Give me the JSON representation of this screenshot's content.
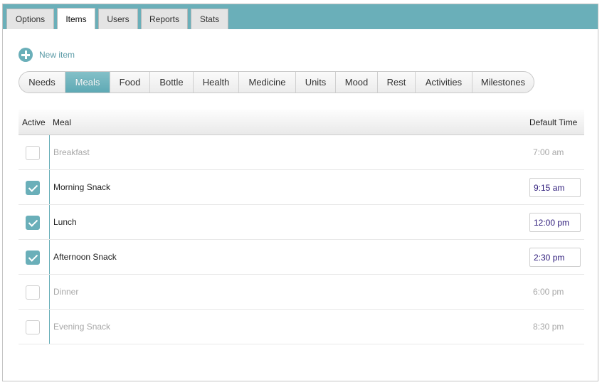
{
  "tabs": [
    {
      "label": "Options",
      "active": false
    },
    {
      "label": "Items",
      "active": true
    },
    {
      "label": "Users",
      "active": false
    },
    {
      "label": "Reports",
      "active": false
    },
    {
      "label": "Stats",
      "active": false
    }
  ],
  "new_item": {
    "label": "New item",
    "icon": "plus-circle-icon"
  },
  "categories": [
    {
      "label": "Needs",
      "active": false
    },
    {
      "label": "Meals",
      "active": true
    },
    {
      "label": "Food",
      "active": false
    },
    {
      "label": "Bottle",
      "active": false
    },
    {
      "label": "Health",
      "active": false
    },
    {
      "label": "Medicine",
      "active": false
    },
    {
      "label": "Units",
      "active": false
    },
    {
      "label": "Mood",
      "active": false
    },
    {
      "label": "Rest",
      "active": false
    },
    {
      "label": "Activities",
      "active": false
    },
    {
      "label": "Milestones",
      "active": false
    }
  ],
  "table": {
    "headers": {
      "active": "Active",
      "meal": "Meal",
      "default_time": "Default Time"
    },
    "rows": [
      {
        "active": false,
        "meal": "Breakfast",
        "time": "7:00 am"
      },
      {
        "active": true,
        "meal": "Morning Snack",
        "time": "9:15 am"
      },
      {
        "active": true,
        "meal": "Lunch",
        "time": "12:00 pm"
      },
      {
        "active": true,
        "meal": "Afternoon Snack",
        "time": "2:30 pm"
      },
      {
        "active": false,
        "meal": "Dinner",
        "time": "6:00 pm"
      },
      {
        "active": false,
        "meal": "Evening Snack",
        "time": "8:30 pm"
      }
    ]
  },
  "colors": {
    "accent": "#6aafb9",
    "time_text": "#2c1a7a",
    "inactive_text": "#a8a8a8"
  }
}
